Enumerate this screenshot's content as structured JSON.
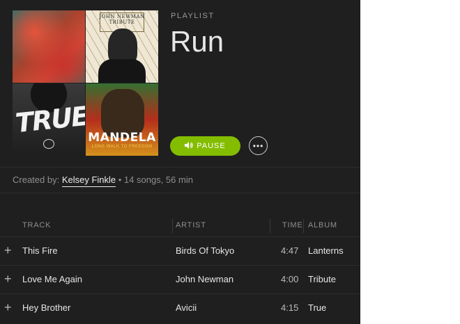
{
  "playlist": {
    "type_label": "PLAYLIST",
    "name": "Run",
    "pause_label": "PAUSE",
    "more_label": "•••",
    "created_by_prefix": "Created by:",
    "creator": "Kelsey Finkle",
    "summary": "• 14 songs, 56 min",
    "accent_color": "#84bd00"
  },
  "cover_art": {
    "tile2_text": "JOHN NEWMAN TRIBUTE",
    "tile3_text": "TRUE",
    "tile4_title": "MANDELA",
    "tile4_sub": "LONG WALK TO FREEDOM"
  },
  "table": {
    "headers": {
      "track": "TRACK",
      "artist": "ARTIST",
      "time": "TIME",
      "album": "ALBUM"
    },
    "rows": [
      {
        "track": "This Fire",
        "artist": "Birds Of Tokyo",
        "time": "4:47",
        "album": "Lanterns"
      },
      {
        "track": "Love Me Again",
        "artist": "John Newman",
        "time": "4:00",
        "album": "Tribute"
      },
      {
        "track": "Hey Brother",
        "artist": "Avicii",
        "time": "4:15",
        "album": "True"
      }
    ]
  }
}
